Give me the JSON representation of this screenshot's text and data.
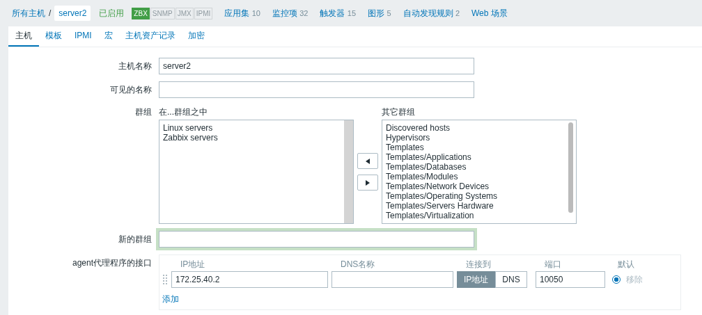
{
  "breadcrumb": {
    "parent": "所有主机",
    "separator": "/",
    "current": "server2"
  },
  "status": {
    "label": "已启用",
    "enabled": true
  },
  "availability": [
    {
      "label": "ZBX",
      "on": true
    },
    {
      "label": "SNMP",
      "on": false
    },
    {
      "label": "JMX",
      "on": false
    },
    {
      "label": "IPMI",
      "on": false
    }
  ],
  "nav_links": [
    {
      "label": "应用集",
      "count": "10"
    },
    {
      "label": "监控项",
      "count": "32"
    },
    {
      "label": "触发器",
      "count": "15"
    },
    {
      "label": "图形",
      "count": "5"
    },
    {
      "label": "自动发现规则",
      "count": "2"
    },
    {
      "label": "Web 场景"
    }
  ],
  "tabs": [
    {
      "label": "主机",
      "selected": true
    },
    {
      "label": "模板",
      "selected": false
    },
    {
      "label": "IPMI",
      "selected": false
    },
    {
      "label": "宏",
      "selected": false
    },
    {
      "label": "主机资产记录",
      "selected": false
    },
    {
      "label": "加密",
      "selected": false
    }
  ],
  "form": {
    "host_name": {
      "label": "主机名称",
      "value": "server2"
    },
    "visible_name": {
      "label": "可见的名称"
    },
    "groups": {
      "label": "群组",
      "in_title": "在...群组之中",
      "in_items": [
        "Linux servers",
        "Zabbix servers"
      ],
      "other_title": "其它群组",
      "other_items": [
        "Discovered hosts",
        "Hypervisors",
        "Templates",
        "Templates/Applications",
        "Templates/Databases",
        "Templates/Modules",
        "Templates/Network Devices",
        "Templates/Operating Systems",
        "Templates/Servers Hardware",
        "Templates/Virtualization"
      ]
    },
    "new_group": {
      "label": "新的群组",
      "focused": true
    },
    "agent_interfaces": {
      "label": "agent代理程序的接口",
      "columns": [
        "IP地址",
        "DNS名称",
        "连接到",
        "端口",
        "默认"
      ],
      "rows": [
        {
          "ip": "172.25.40.2",
          "connect": [
            {
              "label": "IP地址",
              "selected": true
            },
            {
              "label": "DNS",
              "selected": false
            }
          ],
          "port": "10050",
          "default": true,
          "remove": "移除"
        }
      ],
      "add": "添加"
    }
  }
}
